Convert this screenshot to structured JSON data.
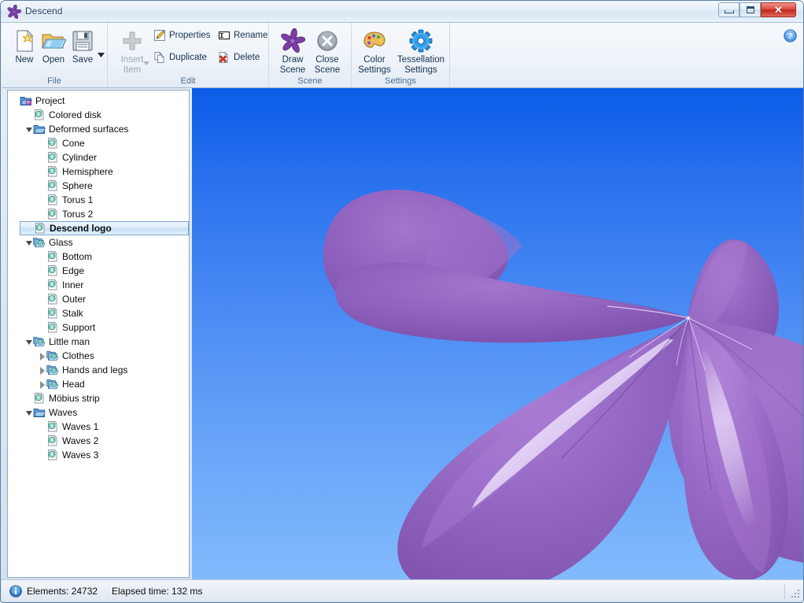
{
  "window": {
    "title": "Descend",
    "app_icon": "descend-star-icon",
    "controls": {
      "minimize": "minimize-icon",
      "maximize": "maximize-icon",
      "close": "close-icon",
      "close_label": "✕"
    }
  },
  "ribbon": {
    "help_icon": "help-icon",
    "groups": [
      {
        "name": "File",
        "label": "File",
        "buttons": [
          {
            "label": "New",
            "icon": "new-document-icon",
            "enabled": true
          },
          {
            "label": "Open",
            "icon": "open-folder-icon",
            "enabled": true
          },
          {
            "label": "Save",
            "icon": "save-diskette-icon",
            "enabled": true
          },
          {
            "label": "",
            "icon": "dropdown-arrow-icon",
            "enabled": true
          }
        ]
      },
      {
        "name": "Edit",
        "label": "Edit",
        "buttons": [
          {
            "label": "Insert\nItem",
            "icon": "plus-insert-icon",
            "enabled": false
          },
          {
            "label": "Properties",
            "icon": "properties-pencil-icon",
            "enabled": true
          },
          {
            "label": "Duplicate",
            "icon": "duplicate-pages-icon",
            "enabled": true
          },
          {
            "label": "Rename",
            "icon": "rename-textbox-icon",
            "enabled": true
          },
          {
            "label": "Delete",
            "icon": "delete-red-x-icon",
            "enabled": true
          }
        ]
      },
      {
        "name": "Scene",
        "label": "Scene",
        "buttons": [
          {
            "label": "Draw\nScene",
            "icon": "draw-scene-star-icon",
            "enabled": true
          },
          {
            "label": "Close\nScene",
            "icon": "close-scene-x-icon",
            "enabled": true
          }
        ]
      },
      {
        "name": "Settings",
        "label": "Settings",
        "buttons": [
          {
            "label": "Color\nSettings",
            "icon": "color-palette-icon",
            "enabled": true
          },
          {
            "label": "Tessellation\nSettings",
            "icon": "tessellation-gear-icon",
            "enabled": true
          }
        ]
      }
    ]
  },
  "tree": {
    "items": [
      {
        "label": "Project",
        "depth": 0,
        "icon": "project-folder-icon",
        "expander": "none",
        "selected": false
      },
      {
        "label": "Colored disk",
        "depth": 1,
        "icon": "surface-icon",
        "expander": "none",
        "selected": false
      },
      {
        "label": "Deformed surfaces",
        "depth": 1,
        "icon": "folder-icon",
        "expander": "open",
        "selected": false
      },
      {
        "label": "Cone",
        "depth": 2,
        "icon": "surface-icon",
        "expander": "none",
        "selected": false
      },
      {
        "label": "Cylinder",
        "depth": 2,
        "icon": "surface-icon",
        "expander": "none",
        "selected": false
      },
      {
        "label": "Hemisphere",
        "depth": 2,
        "icon": "surface-icon",
        "expander": "none",
        "selected": false
      },
      {
        "label": "Sphere",
        "depth": 2,
        "icon": "surface-icon",
        "expander": "none",
        "selected": false
      },
      {
        "label": "Torus 1",
        "depth": 2,
        "icon": "surface-icon",
        "expander": "none",
        "selected": false
      },
      {
        "label": "Torus 2",
        "depth": 2,
        "icon": "surface-icon",
        "expander": "none",
        "selected": false
      },
      {
        "label": "Descend logo",
        "depth": 1,
        "icon": "surface-icon",
        "expander": "none",
        "selected": true
      },
      {
        "label": "Glass",
        "depth": 1,
        "icon": "group-icon",
        "expander": "open",
        "selected": false
      },
      {
        "label": "Bottom",
        "depth": 2,
        "icon": "surface-icon",
        "expander": "none",
        "selected": false
      },
      {
        "label": "Edge",
        "depth": 2,
        "icon": "surface-icon",
        "expander": "none",
        "selected": false
      },
      {
        "label": "Inner",
        "depth": 2,
        "icon": "surface-icon",
        "expander": "none",
        "selected": false
      },
      {
        "label": "Outer",
        "depth": 2,
        "icon": "surface-icon",
        "expander": "none",
        "selected": false
      },
      {
        "label": "Stalk",
        "depth": 2,
        "icon": "surface-icon",
        "expander": "none",
        "selected": false
      },
      {
        "label": "Support",
        "depth": 2,
        "icon": "surface-icon",
        "expander": "none",
        "selected": false
      },
      {
        "label": "Little man",
        "depth": 1,
        "icon": "group-icon",
        "expander": "open",
        "selected": false
      },
      {
        "label": "Clothes",
        "depth": 2,
        "icon": "group-icon",
        "expander": "closed",
        "selected": false
      },
      {
        "label": "Hands and legs",
        "depth": 2,
        "icon": "group-icon",
        "expander": "closed",
        "selected": false
      },
      {
        "label": "Head",
        "depth": 2,
        "icon": "group-icon",
        "expander": "closed",
        "selected": false
      },
      {
        "label": "Möbius strip",
        "depth": 1,
        "icon": "surface-icon",
        "expander": "none",
        "selected": false
      },
      {
        "label": "Waves",
        "depth": 1,
        "icon": "folder-icon",
        "expander": "open",
        "selected": false
      },
      {
        "label": "Waves 1",
        "depth": 2,
        "icon": "surface-icon",
        "expander": "none",
        "selected": false
      },
      {
        "label": "Waves 2",
        "depth": 2,
        "icon": "surface-icon",
        "expander": "none",
        "selected": false
      },
      {
        "label": "Waves 3",
        "depth": 2,
        "icon": "surface-icon",
        "expander": "none",
        "selected": false
      }
    ]
  },
  "viewport": {
    "name": "3d-scene-viewport",
    "background_top": "#0b5ce8",
    "background_bottom": "#82bafc",
    "object_name": "descend-logo-surface",
    "object_color": "#8b5cb8",
    "object_highlight": "#cdb0e8",
    "object_shadow": "#6b4594"
  },
  "statusbar": {
    "info_icon": "info-icon",
    "elements_text": "Elements: 24732",
    "elapsed_text": "Elapsed time: 132 ms",
    "resize_grip": "resize-grip-icon"
  }
}
